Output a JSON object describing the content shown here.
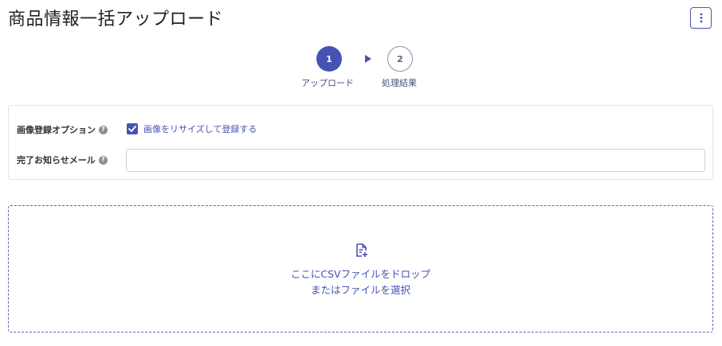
{
  "page": {
    "title": "商品情報一括アップロード"
  },
  "header": {
    "menu_icon": "more-vertical-icon",
    "accent_color": "#4553b5"
  },
  "stepper": {
    "steps": [
      {
        "number": "1",
        "label": "アップロード",
        "state": "active"
      },
      {
        "number": "2",
        "label": "処理結果",
        "state": "inactive"
      }
    ],
    "separator_icon": "triangle-right-icon"
  },
  "options": {
    "image_option": {
      "label": "画像登録オプション",
      "help_icon": "?",
      "checkbox_label": "画像をリサイズして登録する",
      "checked": true
    },
    "notification_email": {
      "label": "完了お知らせメール",
      "help_icon": "?",
      "value": "",
      "placeholder": ""
    }
  },
  "dropzone": {
    "icon": "file-add-icon",
    "line1": "ここにCSVファイルをドロップ",
    "line2": "またはファイルを選択"
  }
}
